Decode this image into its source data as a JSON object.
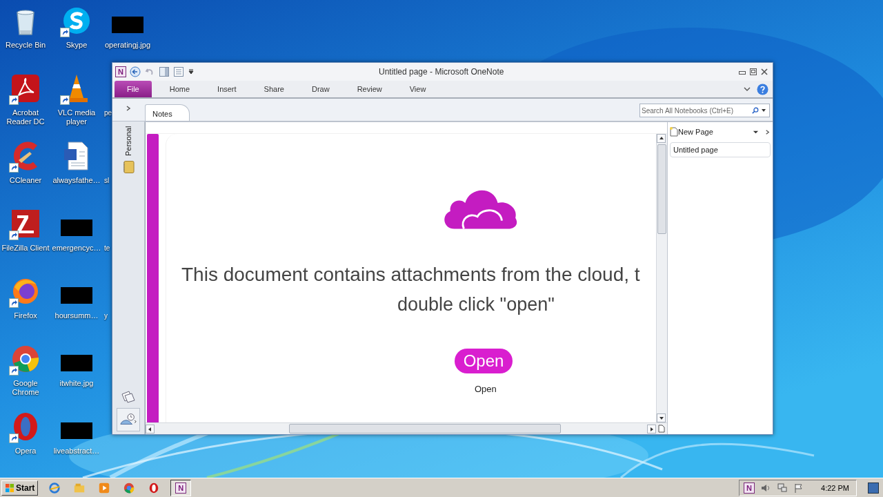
{
  "desktop": {
    "icons": [
      {
        "label": "Recycle Bin",
        "kind": "app",
        "shortcut": false
      },
      {
        "label": "Acrobat Reader DC",
        "kind": "app",
        "shortcut": true
      },
      {
        "label": "CCleaner",
        "kind": "app",
        "shortcut": true
      },
      {
        "label": "FileZilla Client",
        "kind": "app",
        "shortcut": true
      },
      {
        "label": "Firefox",
        "kind": "app",
        "shortcut": true
      },
      {
        "label": "Google Chrome",
        "kind": "app",
        "shortcut": true
      },
      {
        "label": "Opera",
        "kind": "app",
        "shortcut": true
      },
      {
        "label": "Skype",
        "kind": "app",
        "shortcut": true
      },
      {
        "label": "VLC media player",
        "kind": "app",
        "shortcut": true
      },
      {
        "label": "alwaysfathe…",
        "kind": "app",
        "shortcut": false
      },
      {
        "label": "emergencyc…",
        "kind": "thumbnail"
      },
      {
        "label": "hoursumm…",
        "kind": "thumbnail"
      },
      {
        "label": "itwhite.jpg",
        "kind": "thumbnail"
      },
      {
        "label": "liveabstract…",
        "kind": "thumbnail"
      },
      {
        "label": "operatingj.jpg",
        "kind": "thumbnail"
      },
      {
        "label": "pe",
        "kind": "partial"
      },
      {
        "label": "sl",
        "kind": "partial"
      },
      {
        "label": "te",
        "kind": "partial"
      },
      {
        "label": "y",
        "kind": "partial"
      }
    ]
  },
  "window": {
    "app_glyph": "N",
    "title": "Untitled page - Microsoft OneNote",
    "ribbon_tabs": [
      {
        "label": "File",
        "selected": true
      },
      {
        "label": "Home",
        "selected": false
      },
      {
        "label": "Insert",
        "selected": false
      },
      {
        "label": "Share",
        "selected": false
      },
      {
        "label": "Draw",
        "selected": false
      },
      {
        "label": "Review",
        "selected": false
      },
      {
        "label": "View",
        "selected": false
      }
    ],
    "section_tabs": [
      {
        "label": "Notes",
        "selected": true
      }
    ],
    "search": {
      "placeholder": "Search All Notebooks (Ctrl+E)"
    },
    "notebook": {
      "label": "Personal"
    },
    "page": {
      "message": "This document contains attachments from the cloud, t",
      "message_line2": "double click \"open\"",
      "button": "Open",
      "caption": "Open"
    },
    "page_list": {
      "new_page": "New Page",
      "pages": [
        {
          "label": "Untitled page",
          "selected": true
        }
      ]
    }
  },
  "taskbar": {
    "start": "Start",
    "apps": [
      {
        "selected": false
      },
      {
        "selected": false
      },
      {
        "selected": false
      },
      {
        "selected": false
      },
      {
        "selected": false
      },
      {
        "selected": true,
        "glyph": "N"
      }
    ],
    "tray": {
      "glyph": "N",
      "time": "4:22 PM"
    }
  }
}
